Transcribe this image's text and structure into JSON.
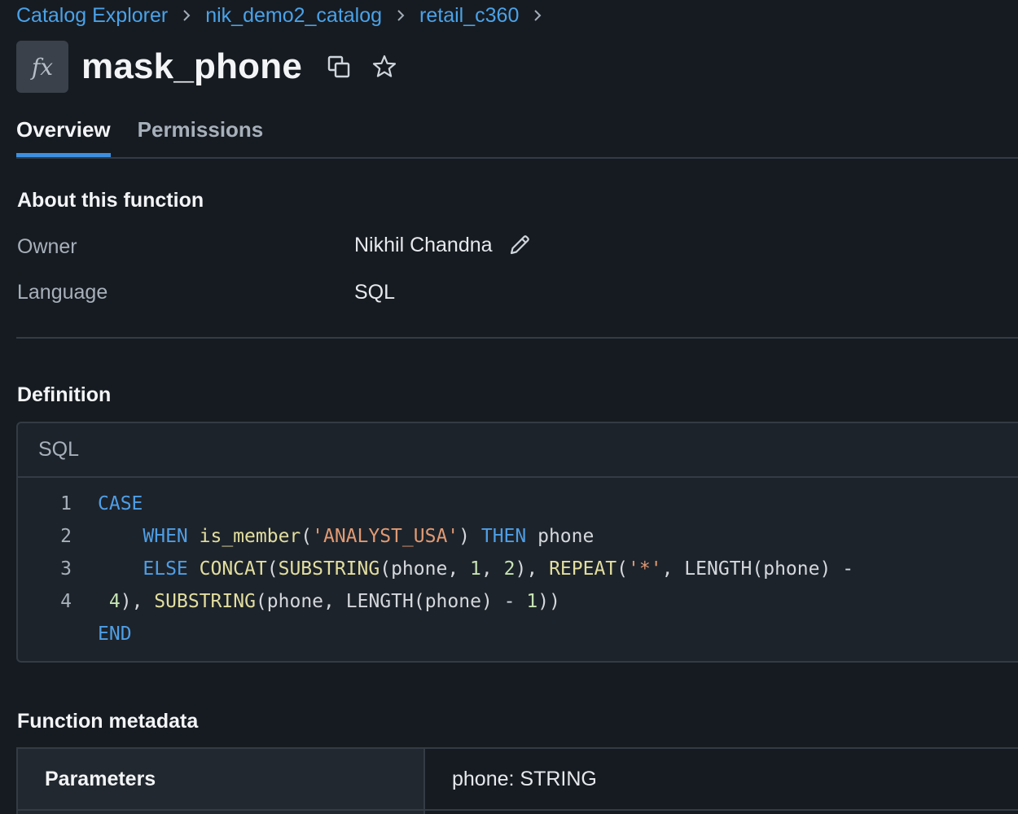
{
  "breadcrumb": {
    "items": [
      "Catalog Explorer",
      "nik_demo2_catalog",
      "retail_c360"
    ]
  },
  "header": {
    "icon_label": "fx",
    "title": "mask_phone"
  },
  "tabs": [
    {
      "label": "Overview",
      "active": true
    },
    {
      "label": "Permissions",
      "active": false
    }
  ],
  "about": {
    "heading": "About this function",
    "owner_label": "Owner",
    "owner_value": "Nikhil Chandna",
    "language_label": "Language",
    "language_value": "SQL"
  },
  "definition": {
    "heading": "Definition",
    "code_language": "SQL",
    "line_numbers": [
      "1",
      "2",
      "3",
      "4"
    ],
    "lines": [
      "CASE",
      "    WHEN is_member('ANALYST_USA') THEN phone",
      "    ELSE CONCAT(SUBSTRING(phone, 1, 2), REPEAT('*', LENGTH(phone) -",
      " 4), SUBSTRING(phone, LENGTH(phone) - 1))",
      "END"
    ]
  },
  "metadata": {
    "heading": "Function metadata",
    "rows": [
      {
        "key": "Parameters",
        "value": "phone: STRING"
      }
    ]
  },
  "colors": {
    "background": "#161b21",
    "link": "#4aa2e8",
    "keyword": "#4e9ee6",
    "function": "#e2dea0",
    "string": "#e19a74",
    "tab_underline": "#3d8fe0"
  }
}
